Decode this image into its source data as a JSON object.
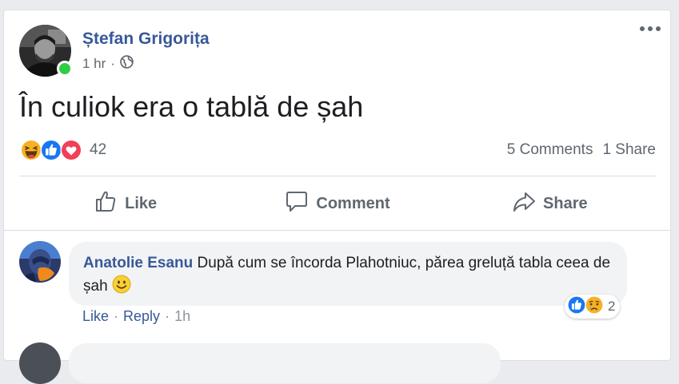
{
  "post": {
    "author": "Ștefan Grigorița",
    "time": "1 hr",
    "separator": "·",
    "text": "În culiok era o tablă de șah",
    "reaction_count": "42",
    "comments_count": "5 Comments",
    "shares_count": "1 Share",
    "reaction_icons": [
      "haha-icon",
      "like-icon",
      "love-icon"
    ],
    "online": true
  },
  "actions": {
    "like": "Like",
    "comment": "Comment",
    "share": "Share"
  },
  "comment": {
    "author": "Anatolie Esanu",
    "text": "După cum se încorda Plahotniuc, părea greluță tabla ceea de șah",
    "emoji": "smiley-icon",
    "reaction_count": "2",
    "reaction_icons": [
      "like-icon",
      "sad-icon"
    ],
    "like_label": "Like",
    "reply_label": "Reply",
    "separator": "·",
    "time": "1h"
  },
  "colors": {
    "link": "#385898",
    "secondary_text": "#606770",
    "online": "#31cc46",
    "like_blue": "#1877f2",
    "love_red": "#f33e58",
    "haha_yellow": "#f7b125"
  }
}
